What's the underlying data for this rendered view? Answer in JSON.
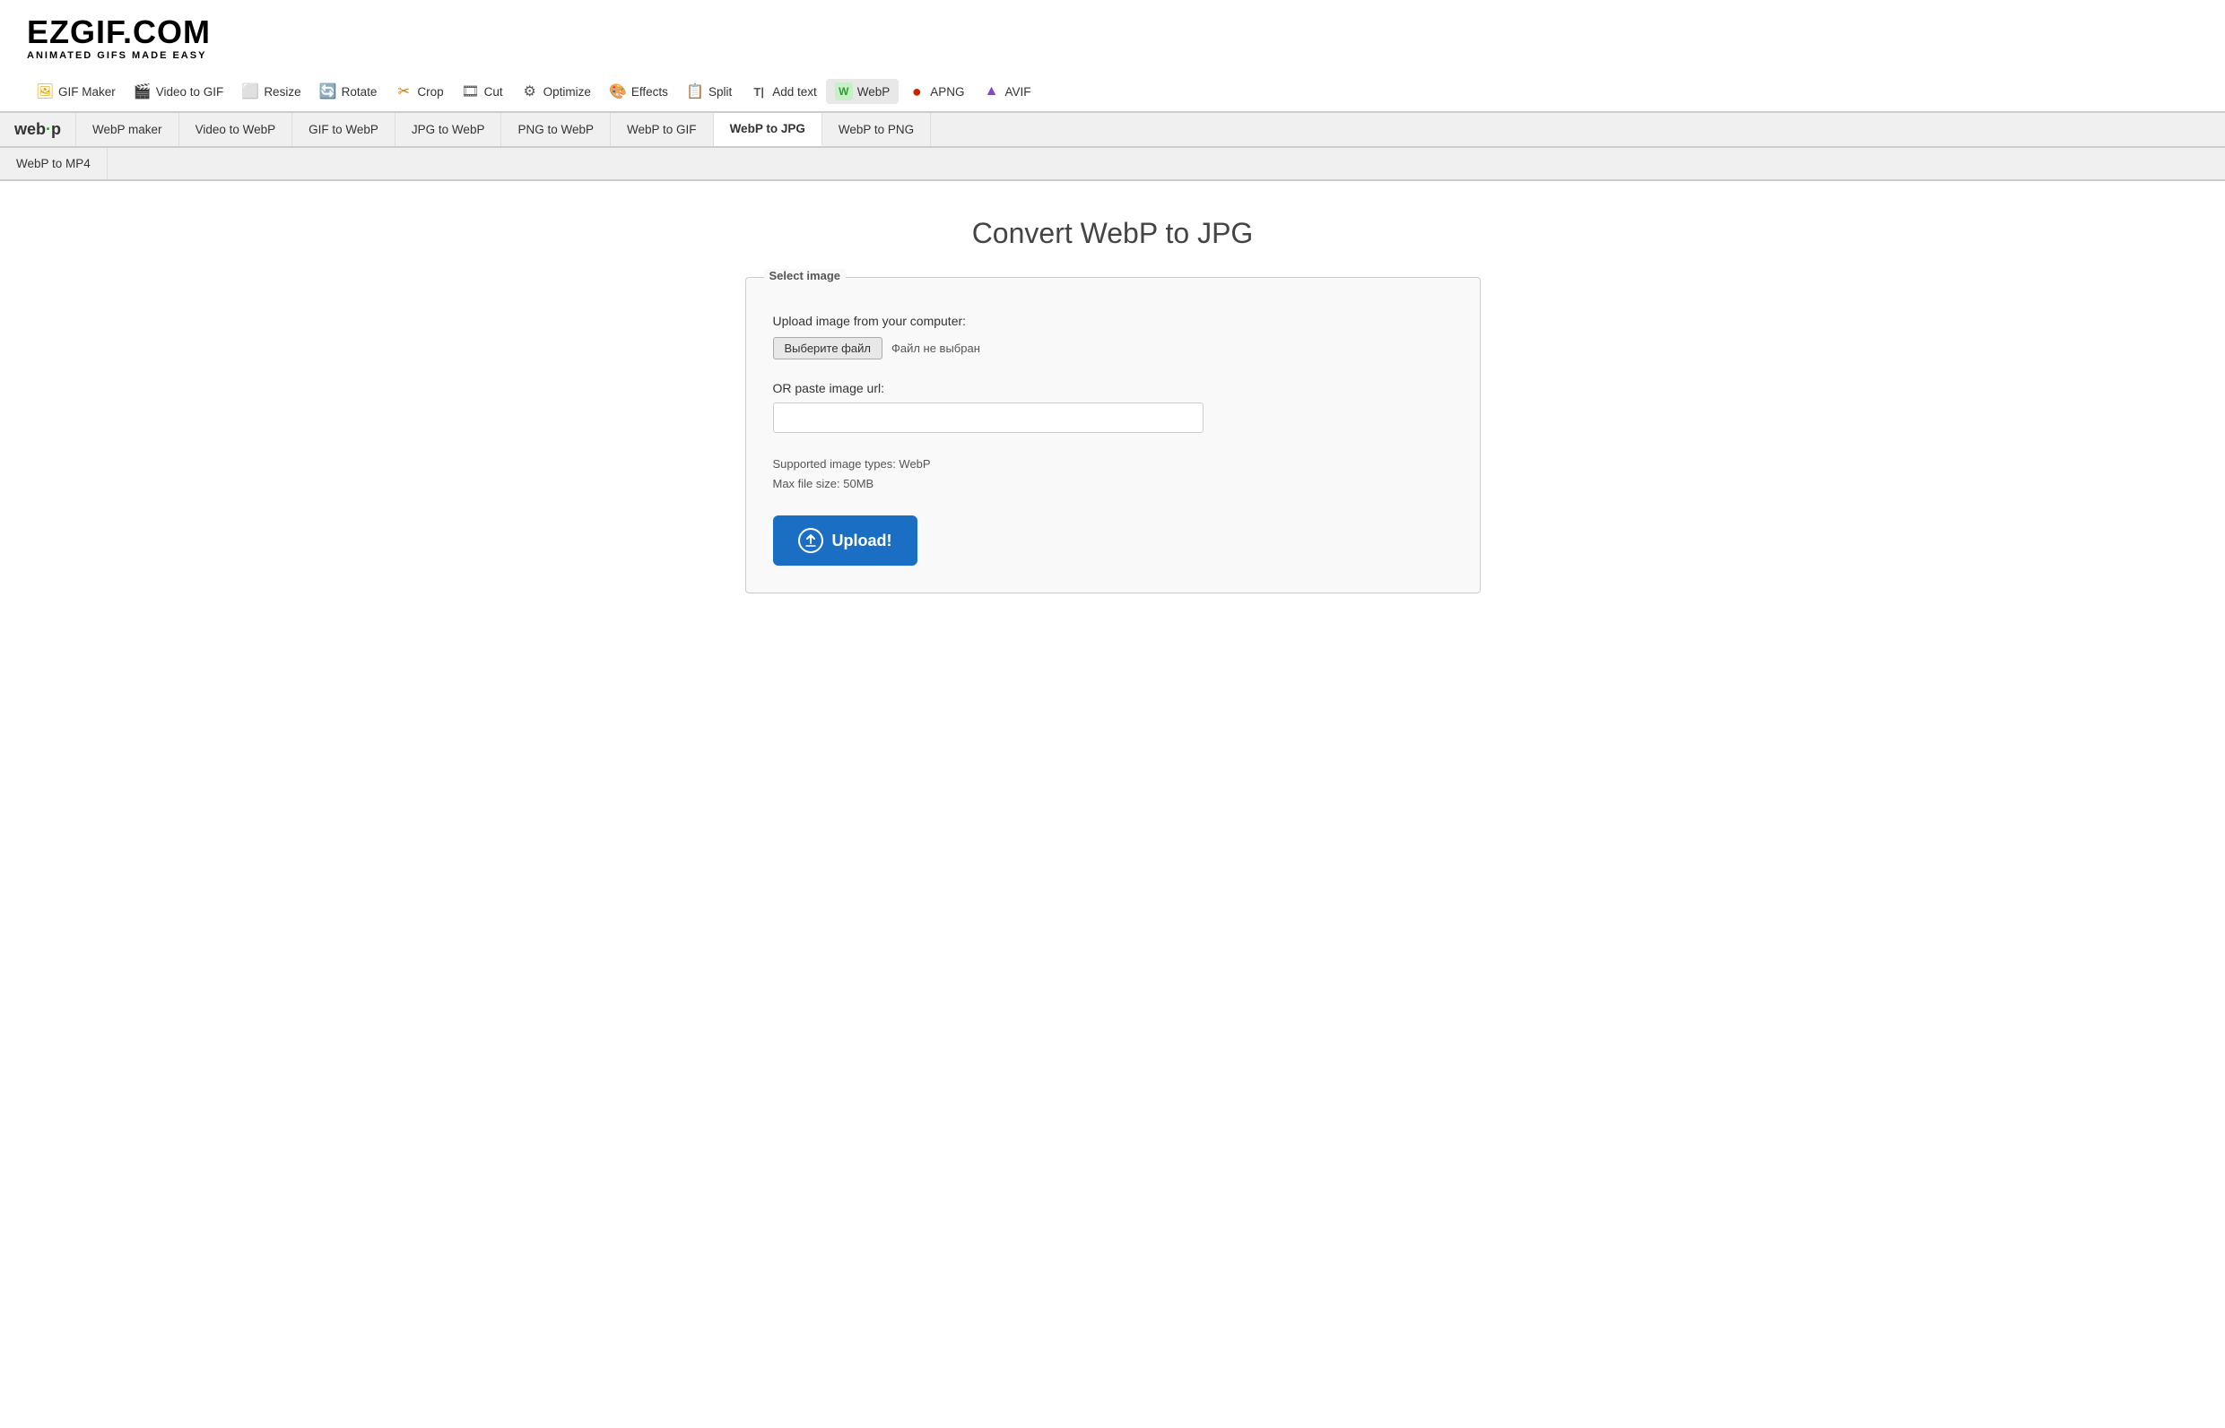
{
  "logo": {
    "title": "EZGIF.COM",
    "subtitle": "ANIMATED GIFS MADE EASY"
  },
  "topnav": {
    "items": [
      {
        "id": "gif-maker",
        "label": "GIF Maker",
        "icon": "🖼"
      },
      {
        "id": "video-to-gif",
        "label": "Video to GIF",
        "icon": "🎬"
      },
      {
        "id": "resize",
        "label": "Resize",
        "icon": "⬜"
      },
      {
        "id": "rotate",
        "label": "Rotate",
        "icon": "🔄"
      },
      {
        "id": "crop",
        "label": "Crop",
        "icon": "✂"
      },
      {
        "id": "cut",
        "label": "Cut",
        "icon": "🎞"
      },
      {
        "id": "optimize",
        "label": "Optimize",
        "icon": "⚙"
      },
      {
        "id": "effects",
        "label": "Effects",
        "icon": "🎨"
      },
      {
        "id": "split",
        "label": "Split",
        "icon": "📋"
      },
      {
        "id": "add-text",
        "label": "Add text",
        "icon": "T"
      },
      {
        "id": "webp",
        "label": "WebP",
        "icon": "W",
        "active": true
      }
    ],
    "row2": [
      {
        "id": "apng",
        "label": "APNG",
        "icon": "🔴"
      },
      {
        "id": "avif",
        "label": "AVIF",
        "icon": "🔷"
      }
    ]
  },
  "webpnav": {
    "logo": "web·p",
    "items": [
      {
        "id": "webp-maker",
        "label": "WebP maker"
      },
      {
        "id": "video-to-webp",
        "label": "Video to WebP"
      },
      {
        "id": "gif-to-webp",
        "label": "GIF to WebP"
      },
      {
        "id": "jpg-to-webp",
        "label": "JPG to WebP"
      },
      {
        "id": "png-to-webp",
        "label": "PNG to WebP"
      },
      {
        "id": "webp-to-gif",
        "label": "WebP to GIF"
      },
      {
        "id": "webp-to-jpg",
        "label": "WebP to JPG",
        "active": true
      },
      {
        "id": "webp-to-png",
        "label": "WebP to PNG"
      }
    ],
    "row2": [
      {
        "id": "webp-to-mp4",
        "label": "WebP to MP4"
      }
    ]
  },
  "main": {
    "title": "Convert WebP to JPG",
    "form": {
      "fieldset_label": "Select image",
      "upload_label": "Upload image from your computer:",
      "file_button_label": "Выберите файл",
      "file_no_file": "Файл не выбран",
      "or_paste_label": "OR paste image url:",
      "url_placeholder": "",
      "supported_types": "Supported image types: WebP",
      "max_file_size": "Max file size: 50MB",
      "upload_button": "Upload!"
    }
  }
}
